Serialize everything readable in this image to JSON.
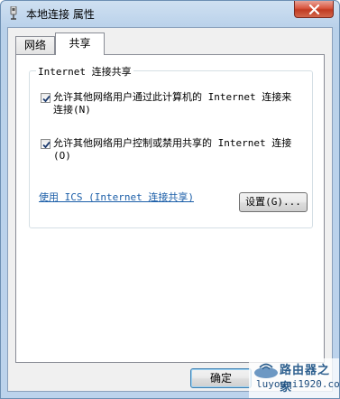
{
  "window": {
    "title": "本地连接 属性",
    "close_icon": "close-icon",
    "title_icon": "network-adapter-icon"
  },
  "tabs": [
    {
      "label": "网络",
      "active": false
    },
    {
      "label": "共享",
      "active": true
    }
  ],
  "sharing": {
    "group_label": "Internet 连接共享",
    "allow_connect": {
      "checked": true,
      "label": "允许其他网络用户通过此计算机的 Internet 连接来连接(N)"
    },
    "allow_control": {
      "checked": true,
      "label": "允许其他网络用户控制或禁用共享的 Internet 连接(O)"
    },
    "ics_link": "使用 ICS (Internet 连接共享)",
    "settings_button": "设置(G)..."
  },
  "footer": {
    "ok_button": "确定"
  },
  "watermark": {
    "name": "路由器之家",
    "url": "luyouqi1920.com"
  },
  "colors": {
    "link": "#1b5ea8",
    "title_bar": "#b9d1ea",
    "close_button": "#c13b22"
  }
}
